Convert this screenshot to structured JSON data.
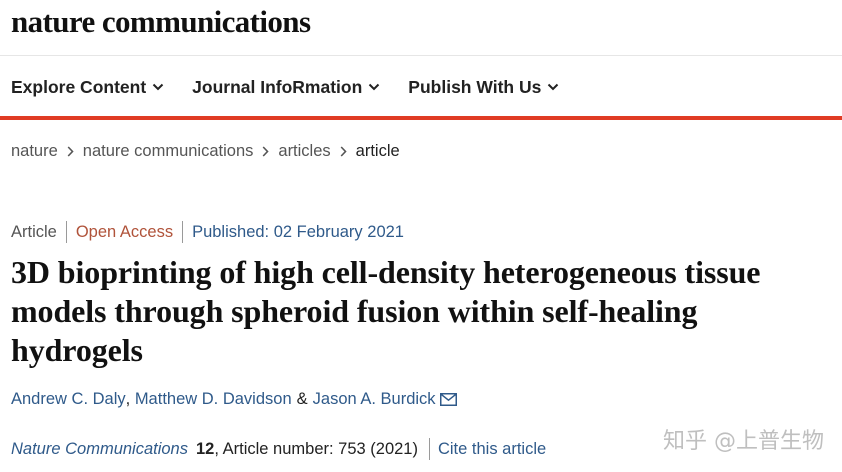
{
  "brand": {
    "logo_text": "nature communications"
  },
  "nav": {
    "items": [
      {
        "label": "Explore Content"
      },
      {
        "label": "Journal InfoRmation"
      },
      {
        "label": "Publish With Us"
      }
    ]
  },
  "breadcrumb": {
    "items": [
      "nature",
      "nature communications",
      "articles",
      "article"
    ]
  },
  "article": {
    "type": "Article",
    "access": "Open Access",
    "published": "Published: 02 February 2021",
    "title": "3D bioprinting of high cell-density heterogeneous tissue models through spheroid fusion within self-healing hydrogels",
    "authors": [
      "Andrew C. Daly",
      "Matthew D. Davidson",
      "Jason A. Burdick"
    ],
    "author_sep": ",",
    "author_amp": "&",
    "journal": "Nature Communications",
    "volume": "12",
    "article_number": ", Article number: 753 (2021)",
    "cite_label": "Cite this article"
  },
  "watermark": "知乎 @上普生物",
  "colors": {
    "accent_red": "#e03b24",
    "link_blue": "#2f5a8a",
    "open_access": "#b0533a"
  }
}
